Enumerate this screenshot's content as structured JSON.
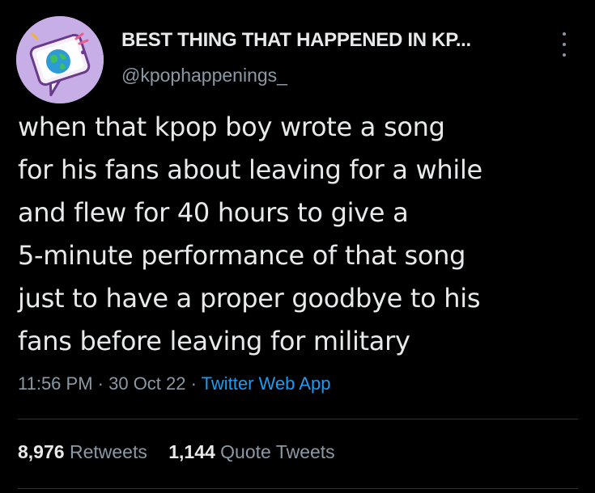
{
  "author": {
    "display_name": "BEST THING THAT HAPPENED IN KP...",
    "handle": "@kpophappenings_",
    "avatar_icon": "phone-globe-icon"
  },
  "tweet": {
    "lines": [
      "when that kpop boy wrote a song",
      "for his fans about leaving for a while",
      "and flew for 40 hours to give a",
      "5-minute performance of that song",
      "just to have a proper goodbye to his",
      "fans before leaving for military"
    ],
    "time": "11:56 PM",
    "separator": " · ",
    "date": "30 Oct 22",
    "source": "Twitter Web App"
  },
  "stats": {
    "retweets_count": "8,976",
    "retweets_label": "Retweets",
    "quotes_count": "1,144",
    "quotes_label": "Quote Tweets"
  },
  "colors": {
    "background": "#000000",
    "text": "#e7e9ea",
    "secondary": "#8b98a5",
    "link": "#1d9bf0",
    "avatar_bg": "#c8aee6"
  }
}
